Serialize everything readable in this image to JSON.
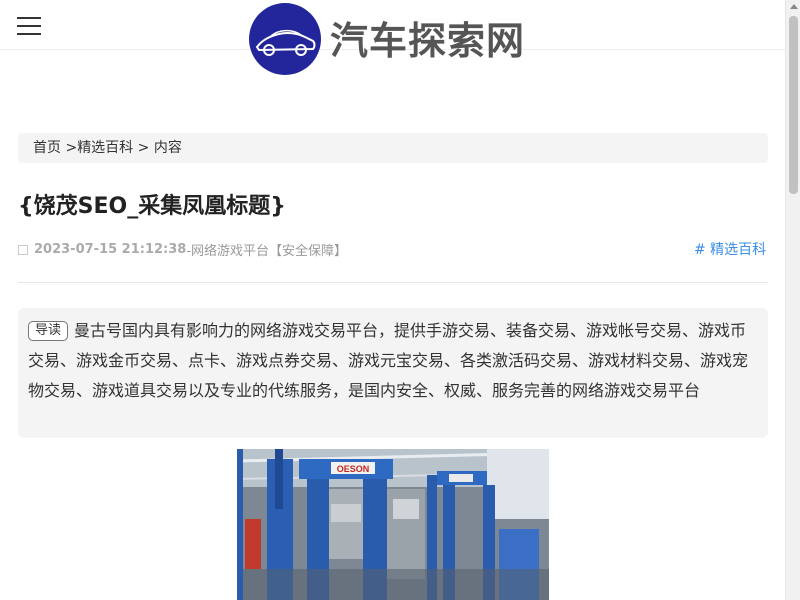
{
  "header": {
    "logo_text": "汽车探索网",
    "logo_icon": "car-silhouette-logo",
    "menu_icon": "hamburger-menu-icon"
  },
  "breadcrumb": {
    "home": "首页",
    "sep1": " >",
    "category": "精选百科",
    "sep2": " > ",
    "current": "内容"
  },
  "article": {
    "title": "{饶茂SEO_采集凤凰标题}",
    "date": "2023-07-15 21:12:38",
    "source": " -网络游戏平台【安全保障】",
    "tag": "# 精选百科",
    "summary_badge": "导读",
    "summary_text": "曼古号国内具有影响力的网络游戏交易平台，提供手游交易、装备交易、游戏帐号交易、游戏币交易、游戏金币交易、点卡、游戏点券交易、游戏元宝交易、各类激活码交易、游戏材料交易、游戏宠物交易、游戏道具交易以及专业的代练服务，是国内安全、权威、服务完善的网络游戏交易平台"
  },
  "photo": {
    "machine_label": "OESON"
  },
  "colors": {
    "logo_blue": "#23269b",
    "tag_blue": "#3a8ee6",
    "panel_bg": "#f4f4f4"
  }
}
